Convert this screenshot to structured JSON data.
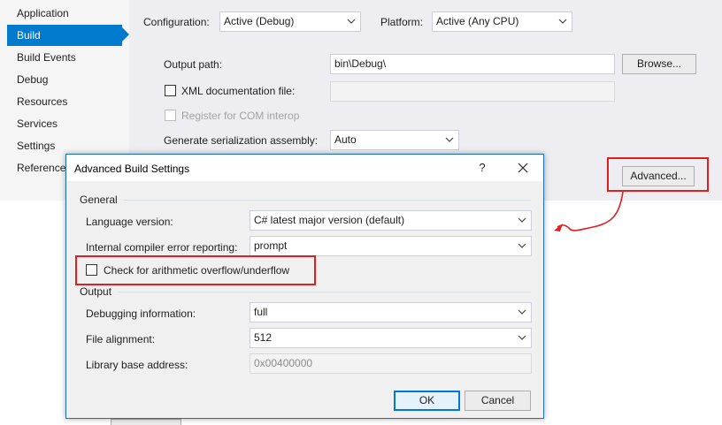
{
  "sidebar": {
    "items": [
      {
        "label": "Application",
        "active": false
      },
      {
        "label": "Build",
        "active": true
      },
      {
        "label": "Build Events",
        "active": false
      },
      {
        "label": "Debug",
        "active": false
      },
      {
        "label": "Resources",
        "active": false
      },
      {
        "label": "Services",
        "active": false
      },
      {
        "label": "Settings",
        "active": false
      },
      {
        "label": "Reference Paths",
        "active": false
      }
    ]
  },
  "build_page": {
    "configuration_label": "Configuration:",
    "configuration_value": "Active (Debug)",
    "platform_label": "Platform:",
    "platform_value": "Active (Any CPU)",
    "output_path_label": "Output path:",
    "output_path_value": "bin\\Debug\\",
    "browse_label": "Browse...",
    "xml_doc_label": "XML documentation file:",
    "xml_doc_checked": false,
    "register_com_label": "Register for COM interop",
    "register_com_checked": false,
    "serialization_label": "Generate serialization assembly:",
    "serialization_value": "Auto",
    "advanced_label": "Advanced..."
  },
  "dialog": {
    "title": "Advanced Build Settings",
    "help_glyph": "?",
    "general_header": "General",
    "language_version_label": "Language version:",
    "language_version_value": "C# latest major version (default)",
    "compiler_error_label": "Internal compiler error reporting:",
    "compiler_error_value": "prompt",
    "overflow_label": "Check for arithmetic overflow/underflow",
    "overflow_checked": false,
    "output_header": "Output",
    "debug_info_label": "Debugging information:",
    "debug_info_value": "full",
    "file_alignment_label": "File alignment:",
    "file_alignment_value": "512",
    "base_address_label": "Library base address:",
    "base_address_value": "0x00400000",
    "ok_label": "OK",
    "cancel_label": "Cancel"
  },
  "colors": {
    "accent": "#007acc",
    "highlight_annotation": "#e02020",
    "dialog_border": "#1f6fb5"
  },
  "icons": [
    "chevron-down-icon",
    "close-icon",
    "checkbox-icon",
    "annotation-arrow-icon"
  ]
}
